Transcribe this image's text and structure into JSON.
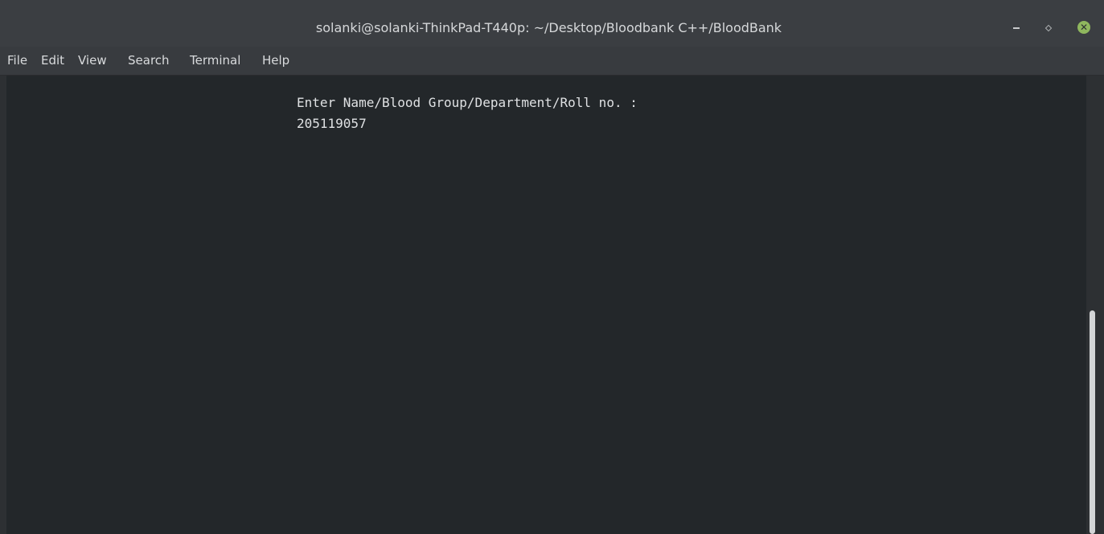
{
  "window": {
    "title": "solanki@solanki-ThinkPad-T440p: ~/Desktop/Bloodbank C++/BloodBank",
    "controls": {
      "minimize_icon": "minimize-icon",
      "maximize_icon": "maximize-icon",
      "close_icon": "close-icon",
      "close_glyph": "✕",
      "close_color": "#8fb75e"
    }
  },
  "menubar": {
    "items": [
      "File",
      "Edit",
      "View",
      "Search",
      "Terminal",
      "Help"
    ]
  },
  "terminal": {
    "lines": [
      "Enter Name/Blood Group/Department/Roll no. :",
      "205119057"
    ],
    "background": "#23272a",
    "foreground": "#dfe1e3"
  }
}
